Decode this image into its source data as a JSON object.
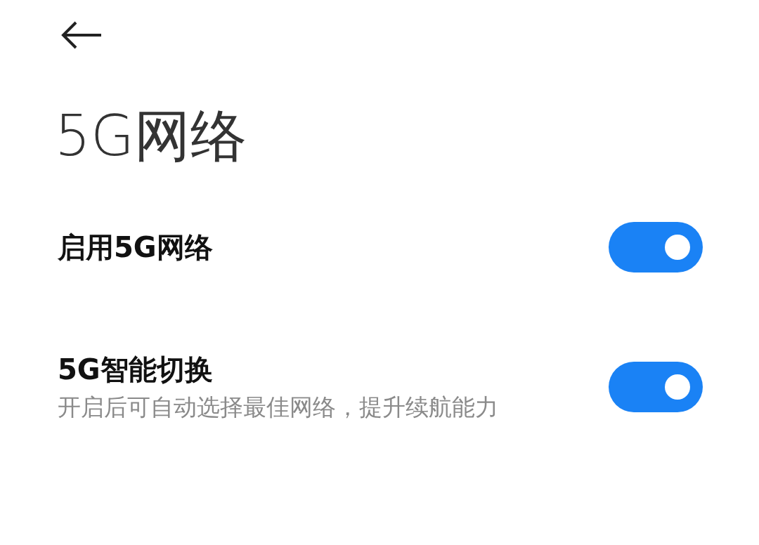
{
  "title": "5G网络",
  "settings": [
    {
      "kind": "switch",
      "label": "启用5G网络",
      "on": true
    },
    {
      "kind": "switch",
      "label": "5G智能切换",
      "description": "开启后可自动选择最佳网络，提升续航能力",
      "on": true
    }
  ]
}
